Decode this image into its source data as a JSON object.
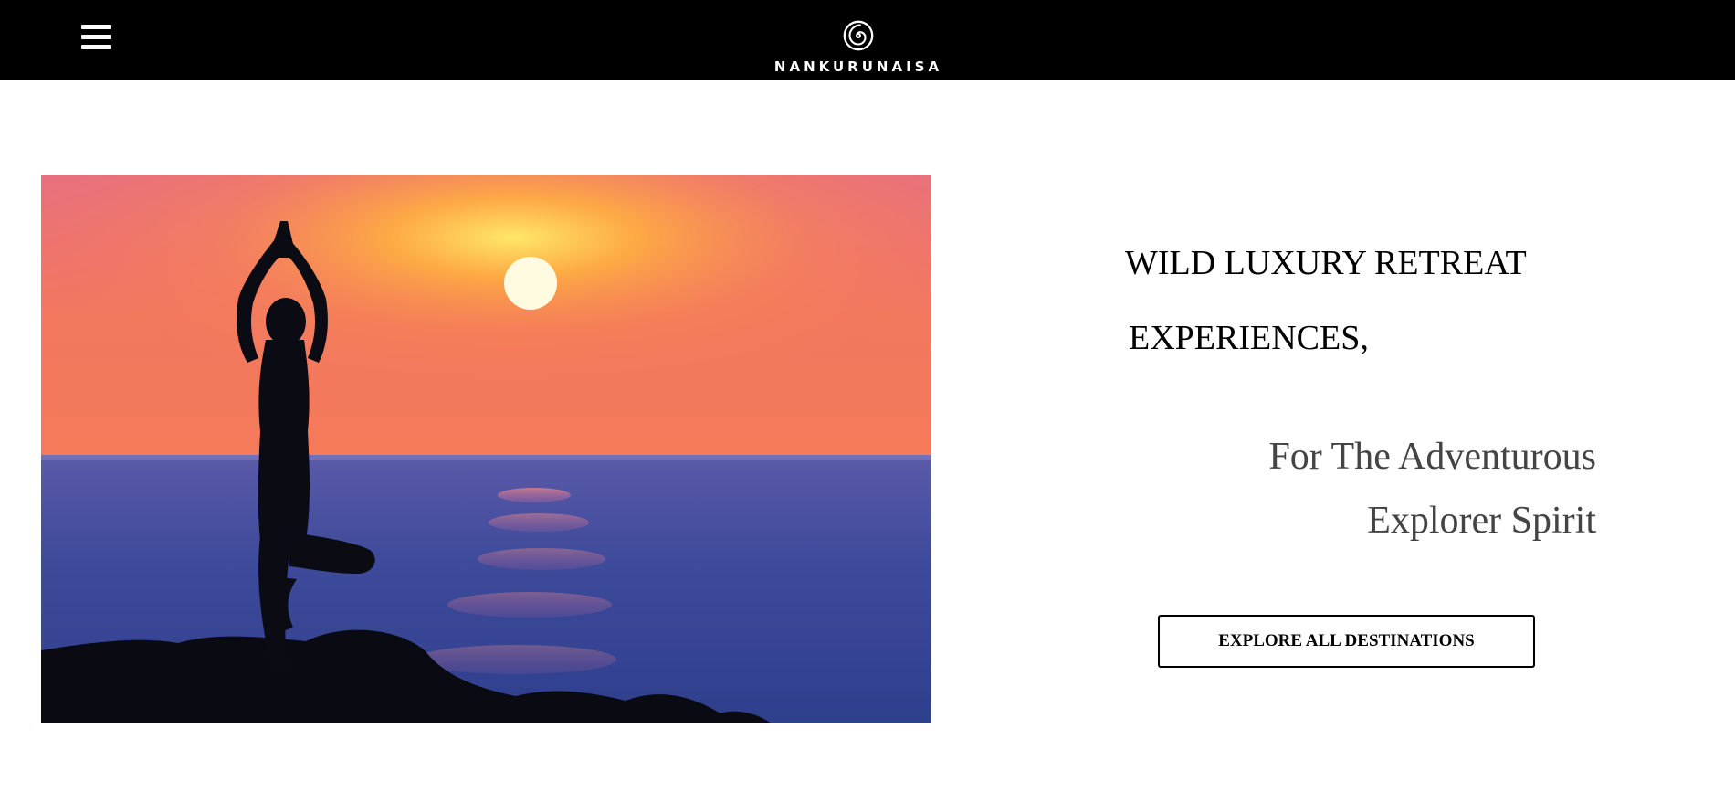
{
  "header": {
    "brand_name": "NANKURUNAISA",
    "menu_icon": "hamburger-menu-icon",
    "logo_icon": "spiral-logo-icon",
    "background_color": "#000000",
    "text_color": "#ffffff"
  },
  "hero": {
    "image_subject": "yoga-silhouette-at-sunset",
    "headline_line_1": "WILD LUXURY RETREAT",
    "headline_line_2": "EXPERIENCES,",
    "subheadline_line_1": "For The Adventurous",
    "subheadline_line_2": "Explorer Spirit",
    "cta_label": "EXPLORE ALL DESTINATIONS"
  }
}
